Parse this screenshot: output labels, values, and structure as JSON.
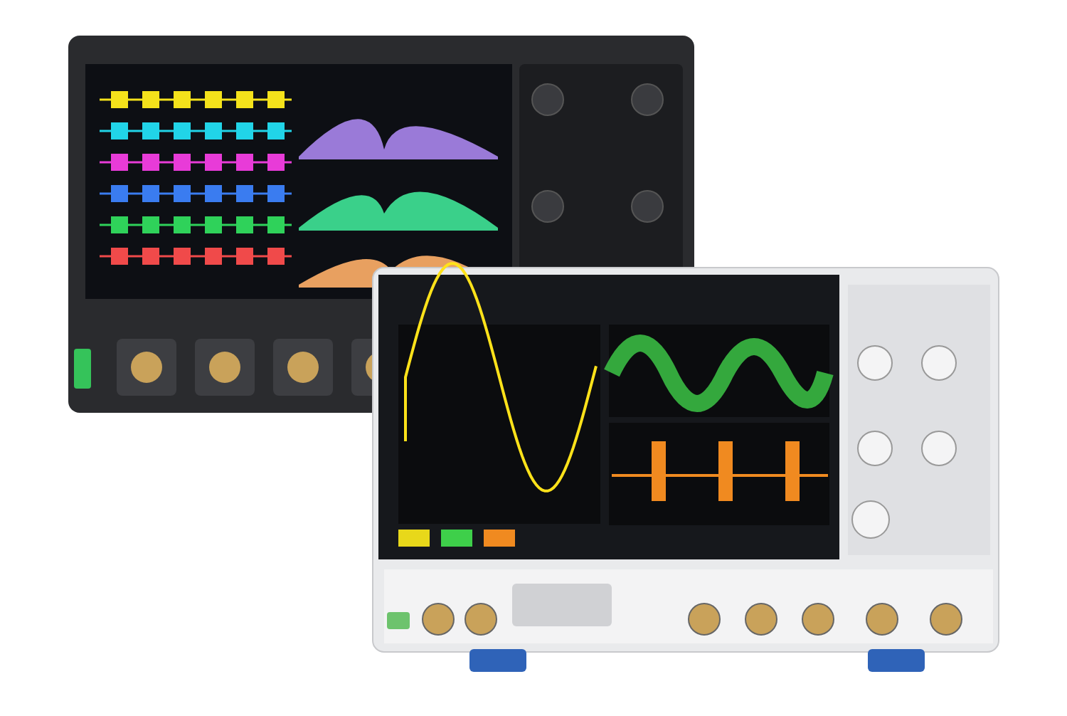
{
  "devices": [
    {
      "kind": "rear"
    },
    {
      "kind": "front"
    }
  ]
}
